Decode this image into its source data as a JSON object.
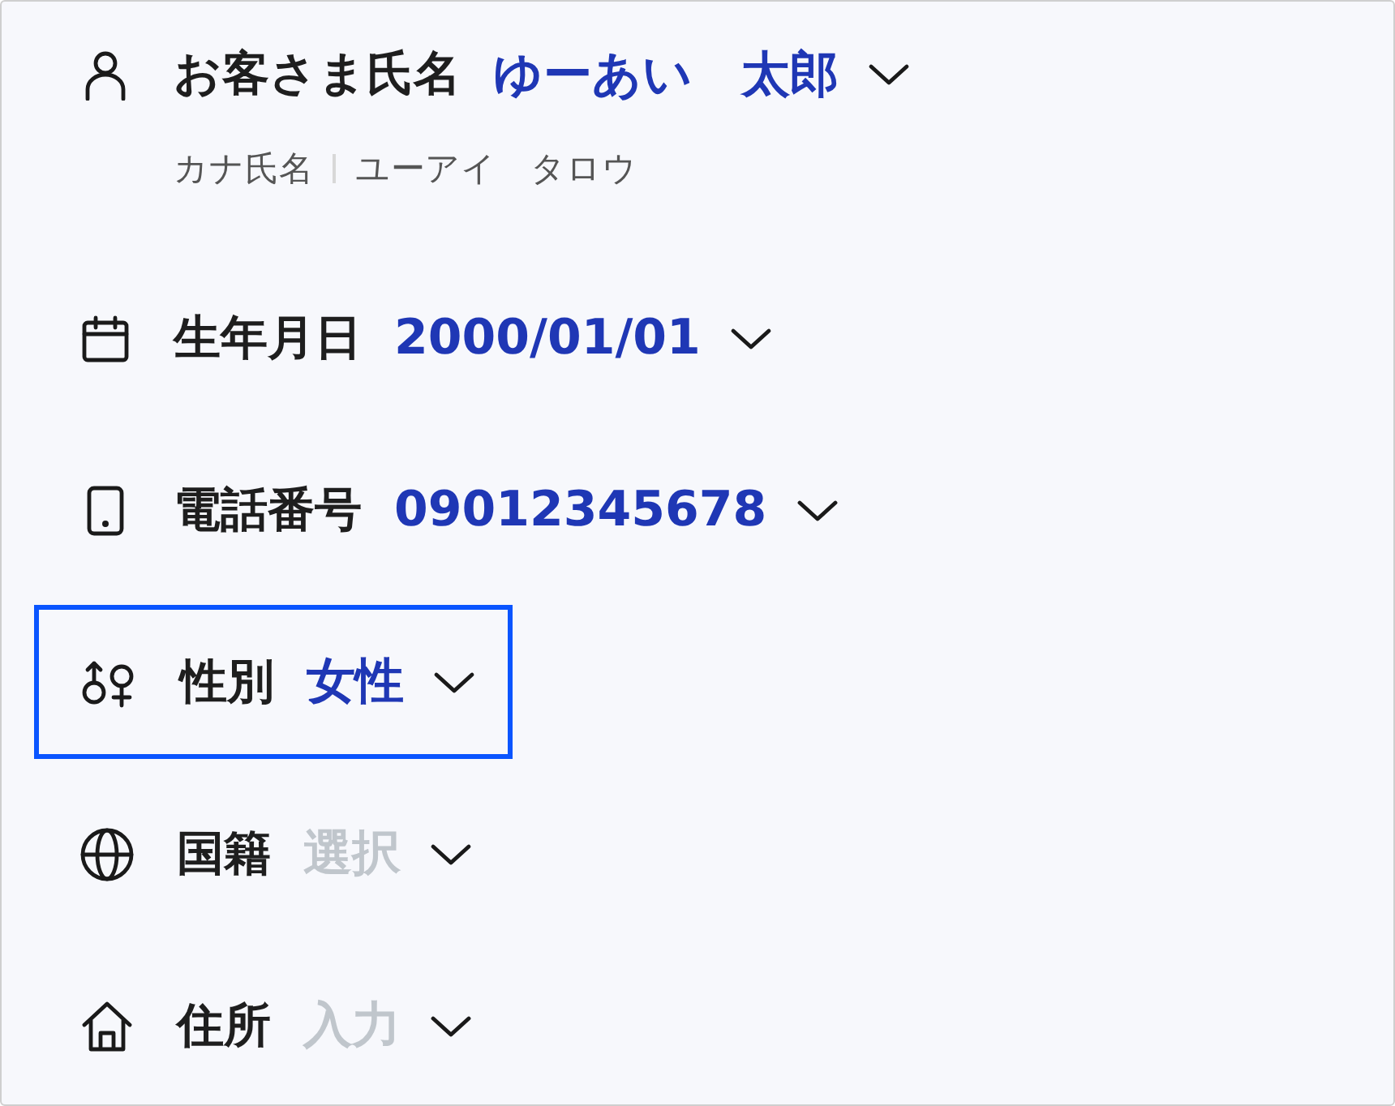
{
  "fields": [
    {
      "kind": "person",
      "label": "お客さま氏名",
      "value": "ゆーあい　太郎",
      "focused": false,
      "sub": {
        "label": "カナ氏名",
        "value": "ユーアイ　タロウ"
      }
    },
    {
      "kind": "calendar",
      "label": "生年月日",
      "value": "2000/01/01",
      "focused": false
    },
    {
      "kind": "phone",
      "label": "電話番号",
      "value": "09012345678",
      "focused": false
    },
    {
      "kind": "gender",
      "label": "性別",
      "value": "女性",
      "focused": true
    },
    {
      "kind": "globe",
      "label": "国籍",
      "placeholder": "選択",
      "focused": false
    },
    {
      "kind": "home",
      "label": "住所",
      "placeholder": "入力",
      "focused": false
    }
  ]
}
